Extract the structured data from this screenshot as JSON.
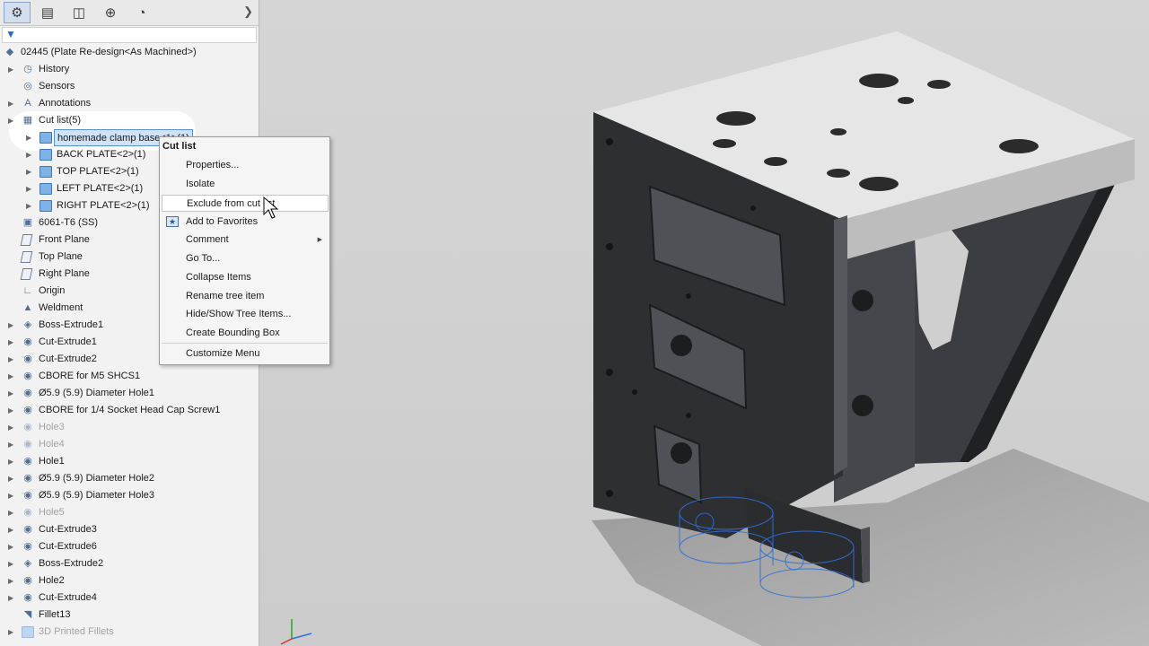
{
  "panel": {
    "tabs": [
      "feature-manager-icon",
      "property-manager-icon",
      "configuration-manager-icon",
      "dimxpert-icon",
      "display-manager-icon"
    ],
    "root_label": "02445  (Plate Re-design<As Machined>)",
    "tree": [
      {
        "label": "History",
        "exp": true,
        "indent": 0,
        "icon": "history-icon"
      },
      {
        "label": "Sensors",
        "exp": false,
        "indent": 0,
        "icon": "sensor-icon"
      },
      {
        "label": "Annotations",
        "exp": true,
        "indent": 0,
        "icon": "annotations-icon"
      },
      {
        "label": "Cut list(5)",
        "exp": true,
        "indent": 0,
        "icon": "cut-list-icon"
      },
      {
        "label": "homemade clamp base<1>(1)",
        "exp": true,
        "indent": 1,
        "icon": "folder-icon",
        "selected": true
      },
      {
        "label": "BACK PLATE<2>(1)",
        "exp": true,
        "indent": 1,
        "icon": "folder-icon"
      },
      {
        "label": "TOP PLATE<2>(1)",
        "exp": true,
        "indent": 1,
        "icon": "folder-icon"
      },
      {
        "label": "LEFT PLATE<2>(1)",
        "exp": true,
        "indent": 1,
        "icon": "folder-icon"
      },
      {
        "label": "RIGHT PLATE<2>(1)",
        "exp": true,
        "indent": 1,
        "icon": "folder-icon"
      },
      {
        "label": "6061-T6 (SS)",
        "exp": false,
        "indent": 0,
        "icon": "material-icon"
      },
      {
        "label": "Front Plane",
        "exp": false,
        "indent": 0,
        "icon": "plane-icon"
      },
      {
        "label": "Top Plane",
        "exp": false,
        "indent": 0,
        "icon": "plane-icon"
      },
      {
        "label": "Right Plane",
        "exp": false,
        "indent": 0,
        "icon": "plane-icon"
      },
      {
        "label": "Origin",
        "exp": false,
        "indent": 0,
        "icon": "origin-icon"
      },
      {
        "label": "Weldment",
        "exp": false,
        "indent": 0,
        "icon": "weldment-icon"
      },
      {
        "label": "Boss-Extrude1",
        "exp": true,
        "indent": 0,
        "icon": "extrude-icon"
      },
      {
        "label": "Cut-Extrude1",
        "exp": true,
        "indent": 0,
        "icon": "cut-extrude-icon"
      },
      {
        "label": "Cut-Extrude2",
        "exp": true,
        "indent": 0,
        "icon": "cut-extrude-icon"
      },
      {
        "label": "CBORE for M5 SHCS1",
        "exp": true,
        "indent": 0,
        "icon": "hole-icon"
      },
      {
        "label": "Ø5.9 (5.9) Diameter Hole1",
        "exp": true,
        "indent": 0,
        "icon": "hole-icon"
      },
      {
        "label": "CBORE for 1/4 Socket Head Cap Screw1",
        "exp": true,
        "indent": 0,
        "icon": "hole-icon"
      },
      {
        "label": "Hole3",
        "exp": true,
        "indent": 0,
        "icon": "hole-icon",
        "dim": true
      },
      {
        "label": "Hole4",
        "exp": true,
        "indent": 0,
        "icon": "hole-icon",
        "dim": true
      },
      {
        "label": "Hole1",
        "exp": true,
        "indent": 0,
        "icon": "hole-icon"
      },
      {
        "label": "Ø5.9 (5.9) Diameter Hole2",
        "exp": true,
        "indent": 0,
        "icon": "hole-icon"
      },
      {
        "label": "Ø5.9 (5.9) Diameter Hole3",
        "exp": true,
        "indent": 0,
        "icon": "hole-icon"
      },
      {
        "label": "Hole5",
        "exp": true,
        "indent": 0,
        "icon": "hole-icon",
        "dim": true
      },
      {
        "label": "Cut-Extrude3",
        "exp": true,
        "indent": 0,
        "icon": "cut-extrude-icon"
      },
      {
        "label": "Cut-Extrude6",
        "exp": true,
        "indent": 0,
        "icon": "cut-extrude-icon"
      },
      {
        "label": "Boss-Extrude2",
        "exp": true,
        "indent": 0,
        "icon": "extrude-icon"
      },
      {
        "label": "Hole2",
        "exp": true,
        "indent": 0,
        "icon": "hole-icon"
      },
      {
        "label": "Cut-Extrude4",
        "exp": true,
        "indent": 0,
        "icon": "cut-extrude-icon"
      },
      {
        "label": "Fillet13",
        "exp": false,
        "indent": 0,
        "icon": "fillet-icon"
      },
      {
        "label": "3D Printed Fillets",
        "exp": true,
        "indent": 0,
        "icon": "folder-icon",
        "dim": true
      }
    ]
  },
  "context_menu": {
    "title": "Cut list",
    "items": [
      {
        "label": "Properties...",
        "name": "menu-properties"
      },
      {
        "label": "Isolate",
        "name": "menu-isolate"
      },
      {
        "label": "Exclude from cut list",
        "name": "menu-exclude-from-cut-list",
        "hover": true
      },
      {
        "label": "Add to Favorites",
        "name": "menu-add-to-favorites",
        "icon": "favorites-icon"
      },
      {
        "label": "Comment",
        "name": "menu-comment",
        "submenu": true
      },
      {
        "label": "Go To...",
        "name": "menu-go-to"
      },
      {
        "label": "Collapse Items",
        "name": "menu-collapse-items"
      },
      {
        "label": "Rename tree item",
        "name": "menu-rename-tree-item"
      },
      {
        "label": "Hide/Show Tree Items...",
        "name": "menu-hide-show-tree-items"
      },
      {
        "label": "Create Bounding Box",
        "name": "menu-create-bounding-box"
      },
      {
        "label": "Customize Menu",
        "name": "menu-customize-menu"
      }
    ]
  },
  "colors": {
    "panel_bg": "#f2f2f2",
    "viewport_bg": "#cfcfcf",
    "part_dark": "#2a2c2f",
    "part_side": "#3a3d41",
    "part_top": "#e4e4e4",
    "selection": "#cfe2f7",
    "sketch_blue": "#2f6fd6"
  }
}
